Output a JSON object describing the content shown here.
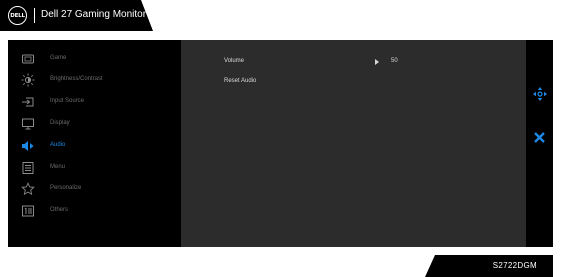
{
  "header": {
    "logo_text": "DELL",
    "title": "Dell 27 Gaming Monitor"
  },
  "menu": {
    "items": [
      {
        "label": "Game",
        "icon": "game-icon",
        "active": false
      },
      {
        "label": "Brightness/Contrast",
        "icon": "brightness-icon",
        "active": false
      },
      {
        "label": "Input Source",
        "icon": "input-source-icon",
        "active": false
      },
      {
        "label": "Display",
        "icon": "display-icon",
        "active": false
      },
      {
        "label": "Audio",
        "icon": "audio-icon",
        "active": true
      },
      {
        "label": "Menu",
        "icon": "menu-icon",
        "active": false
      },
      {
        "label": "Personalize",
        "icon": "star-icon",
        "active": false
      },
      {
        "label": "Others",
        "icon": "others-icon",
        "active": false
      }
    ]
  },
  "content": {
    "volume": {
      "label": "Volume",
      "value": "50"
    },
    "reset_audio": {
      "label": "Reset Audio"
    }
  },
  "model": {
    "name": "S2722DGM"
  },
  "colors": {
    "accent": "#1d88e5",
    "panel_bg": "#2c2c2c",
    "menu_text": "#6b6b6b",
    "content_text": "#d8d8d8"
  }
}
